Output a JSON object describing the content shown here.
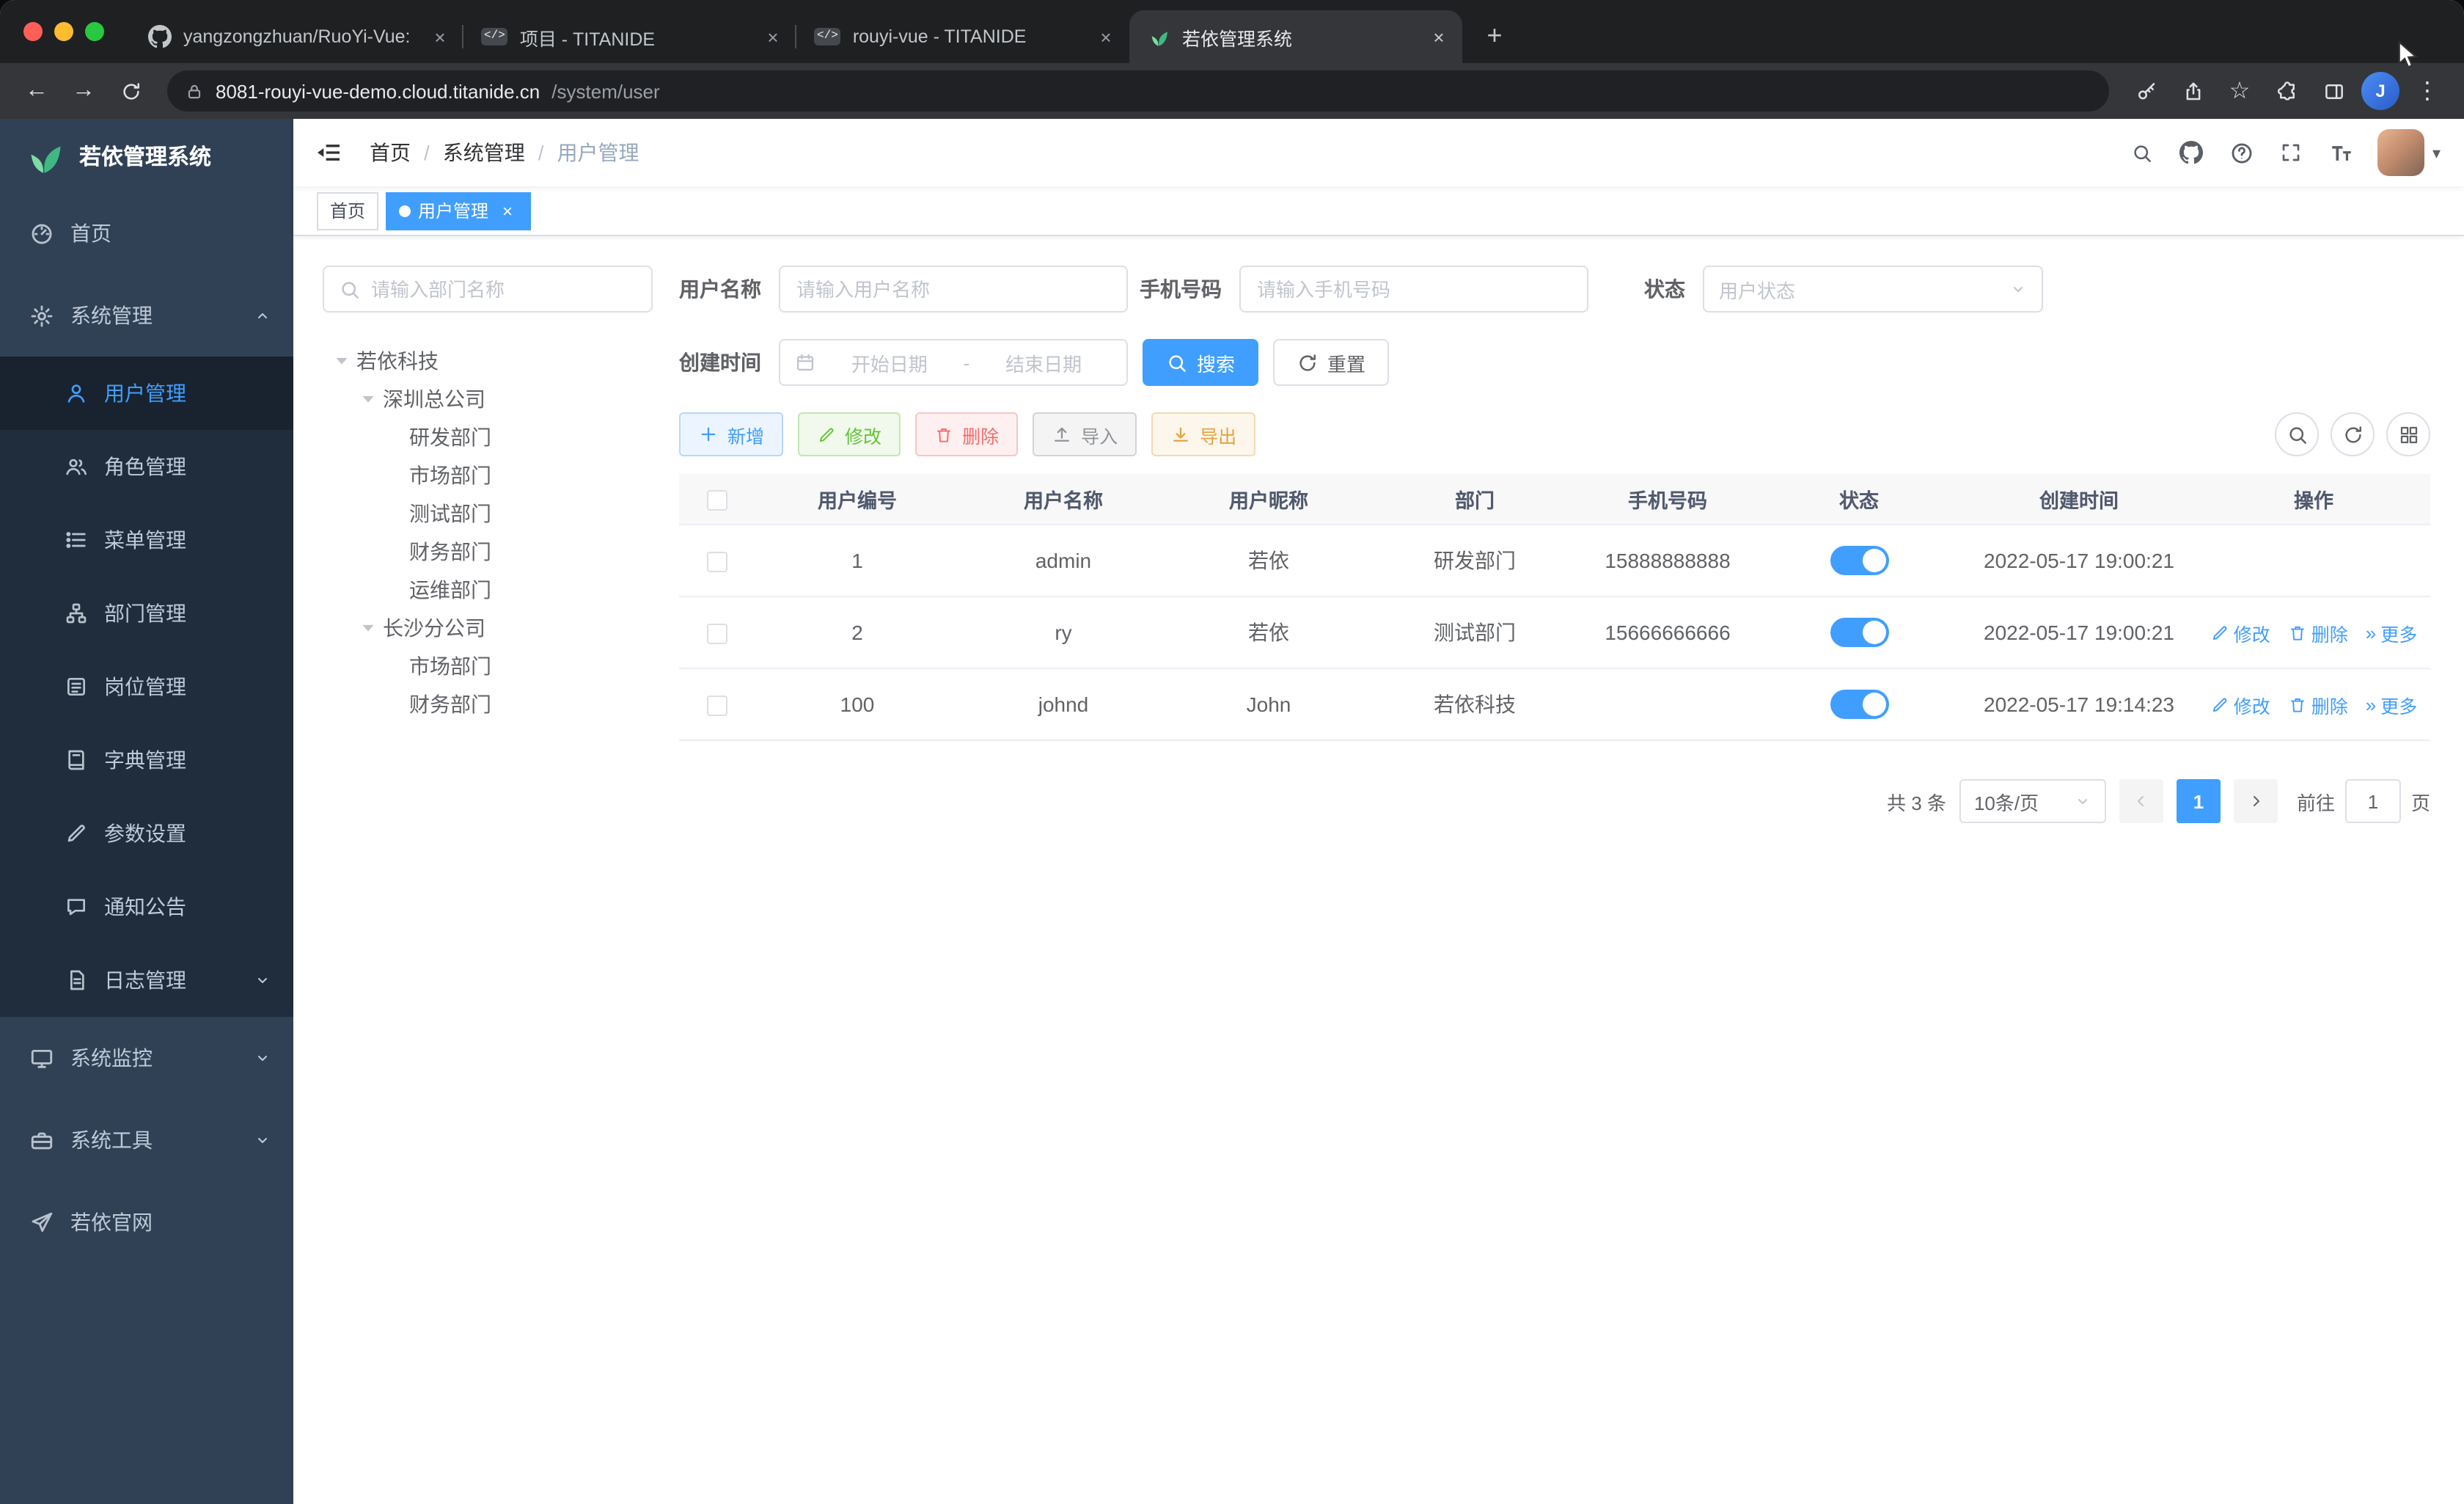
{
  "glyphs": {
    "plus": "+",
    "close": "×",
    "kebab": "⋮",
    "star": "☆",
    "back": "←",
    "forward": "→",
    "slash": "/",
    "dash": "-",
    "more": "»",
    "caret": "▾"
  },
  "browser": {
    "tabs": [
      {
        "title": "yangzongzhuan/RuoYi-Vue: (R",
        "icon": "github",
        "active": false
      },
      {
        "title": "项目 - TITANIDE",
        "icon": "code",
        "active": false
      },
      {
        "title": "rouyi-vue - TITANIDE",
        "icon": "code",
        "active": false
      },
      {
        "title": "若依管理系统",
        "icon": "leaf",
        "active": true
      }
    ],
    "url": {
      "host": "8081-rouyi-vue-demo.cloud.titanide.cn",
      "path": "/system/user"
    },
    "profile_initial": "J"
  },
  "sidebar": {
    "logo": "若依管理系统",
    "menu": [
      {
        "label": "首页",
        "icon": "dashboard"
      },
      {
        "label": "系统管理",
        "icon": "gear",
        "expanded": true,
        "children": [
          {
            "label": "用户管理",
            "icon": "user",
            "active": true
          },
          {
            "label": "角色管理",
            "icon": "peoples"
          },
          {
            "label": "菜单管理",
            "icon": "treetable"
          },
          {
            "label": "部门管理",
            "icon": "orgtree"
          },
          {
            "label": "岗位管理",
            "icon": "post"
          },
          {
            "label": "字典管理",
            "icon": "dict"
          },
          {
            "label": "参数设置",
            "icon": "edit"
          },
          {
            "label": "通知公告",
            "icon": "message"
          },
          {
            "label": "日志管理",
            "icon": "log",
            "collapsible": true
          }
        ]
      },
      {
        "label": "系统监控",
        "icon": "monitor",
        "collapsible": true
      },
      {
        "label": "系统工具",
        "icon": "tool",
        "collapsible": true
      },
      {
        "label": "若依官网",
        "icon": "guide"
      }
    ]
  },
  "navbar": {
    "breadcrumb": [
      "首页",
      "系统管理",
      "用户管理"
    ]
  },
  "tags": [
    {
      "label": "首页",
      "active": false,
      "closable": false
    },
    {
      "label": "用户管理",
      "active": true,
      "closable": true
    }
  ],
  "dept_panel": {
    "search_placeholder": "请输入部门名称",
    "tree": [
      {
        "label": "若依科技",
        "level": 0,
        "expandable": true
      },
      {
        "label": "深圳总公司",
        "level": 1,
        "expandable": true
      },
      {
        "label": "研发部门",
        "level": 2,
        "expandable": false
      },
      {
        "label": "市场部门",
        "level": 2,
        "expandable": false
      },
      {
        "label": "测试部门",
        "level": 2,
        "expandable": false
      },
      {
        "label": "财务部门",
        "level": 2,
        "expandable": false
      },
      {
        "label": "运维部门",
        "level": 2,
        "expandable": false
      },
      {
        "label": "长沙分公司",
        "level": 1,
        "expandable": true
      },
      {
        "label": "市场部门",
        "level": 2,
        "expandable": false
      },
      {
        "label": "财务部门",
        "level": 2,
        "expandable": false
      }
    ]
  },
  "filters": {
    "username_label": "用户名称",
    "username_placeholder": "请输入用户名称",
    "phone_label": "手机号码",
    "phone_placeholder": "请输入手机号码",
    "status_label": "状态",
    "status_placeholder": "用户状态",
    "created_label": "创建时间",
    "date_start": "开始日期",
    "date_end": "结束日期",
    "search_btn": "搜索",
    "reset_btn": "重置"
  },
  "toolbar": {
    "add": "新增",
    "modify": "修改",
    "delete": "删除",
    "import": "导入",
    "export": "导出"
  },
  "table": {
    "columns": [
      "用户编号",
      "用户名称",
      "用户昵称",
      "部门",
      "手机号码",
      "状态",
      "创建时间",
      "操作"
    ],
    "op_labels": {
      "edit": "修改",
      "delete": "删除",
      "more": "更多"
    },
    "rows": [
      {
        "id": "1",
        "username": "admin",
        "nickname": "若依",
        "dept": "研发部门",
        "phone": "15888888888",
        "status": true,
        "created": "2022-05-17 19:00:21",
        "ops": false
      },
      {
        "id": "2",
        "username": "ry",
        "nickname": "若依",
        "dept": "测试部门",
        "phone": "15666666666",
        "status": true,
        "created": "2022-05-17 19:00:21",
        "ops": true
      },
      {
        "id": "100",
        "username": "johnd",
        "nickname": "John",
        "dept": "若依科技",
        "phone": "",
        "status": true,
        "created": "2022-05-17 19:14:23",
        "ops": true
      }
    ]
  },
  "pagination": {
    "total": "共 3 条",
    "page_size": "10条/页",
    "current": "1",
    "goto_label": "前往",
    "goto_value": "1",
    "page_unit": "页"
  }
}
